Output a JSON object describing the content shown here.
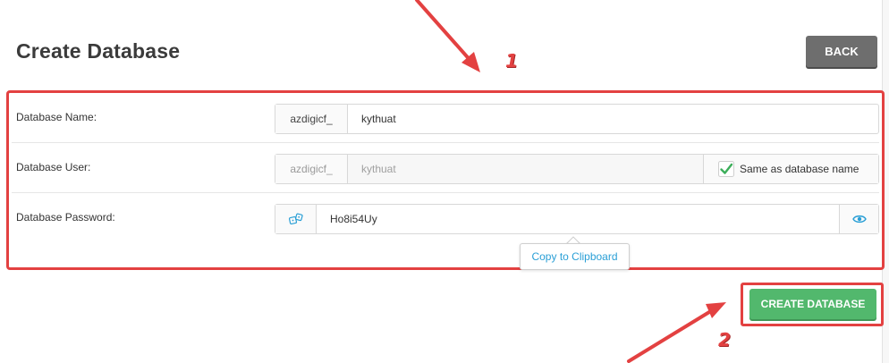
{
  "page": {
    "title": "Create Database",
    "back_label": "BACK"
  },
  "form": {
    "name_row": {
      "label": "Database Name:",
      "prefix": "azdigicf_",
      "value": "kythuat"
    },
    "user_row": {
      "label": "Database User:",
      "prefix": "azdigicf_",
      "value": "kythuat",
      "same_as_label": "Same as database name",
      "same_as_checked": true
    },
    "password_row": {
      "label": "Database Password:",
      "value": "Ho8i54Uy",
      "generate_icon": "dice-icon",
      "reveal_icon": "eye-icon"
    },
    "copy_tooltip": "Copy to Clipboard"
  },
  "actions": {
    "create_label": "CREATE DATABASE"
  },
  "annotations": {
    "step_1": "1",
    "step_2": "2"
  },
  "colors": {
    "annotation_red": "#e34141",
    "create_green": "#52b86d",
    "back_gray": "#6e6e6e",
    "check_green": "#3cae5a",
    "link_blue": "#2a9fd6"
  }
}
